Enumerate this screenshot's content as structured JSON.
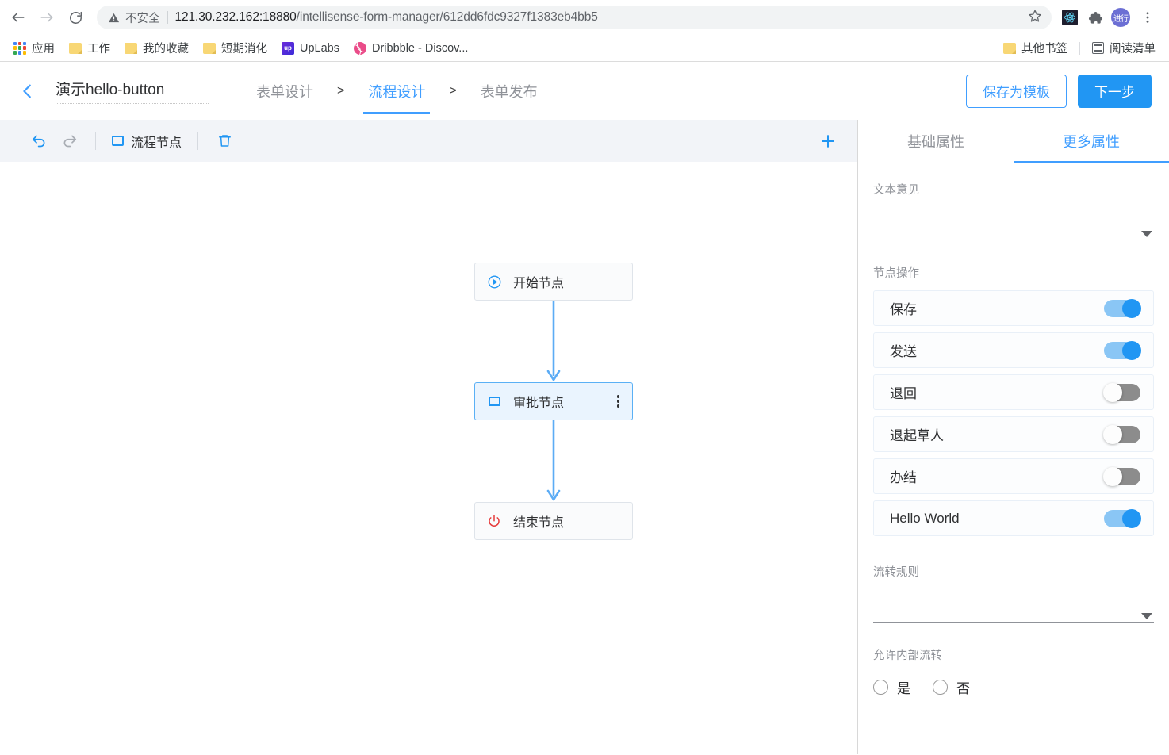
{
  "browser": {
    "nav": {
      "back_label": "Back",
      "forward_label": "Forward",
      "reload_label": "Reload"
    },
    "omnibox": {
      "security_text": "不安全",
      "url_host": "121.30.232.162:18880",
      "url_path": "/intellisense-form-manager/612dd6fdc9327f1383eb4bb5",
      "star_label": "Bookmark"
    },
    "extensions": [
      {
        "name": "react-devtools-icon"
      },
      {
        "name": "puzzle-extensions-icon"
      },
      {
        "name": "profile-avatar",
        "label": "进行"
      },
      {
        "name": "chrome-menu-icon"
      }
    ],
    "bookmarks": [
      {
        "icon": "apps-grid-icon",
        "label": "应用"
      },
      {
        "icon": "folder-icon",
        "label": "工作"
      },
      {
        "icon": "folder-icon",
        "label": "我的收藏"
      },
      {
        "icon": "folder-icon",
        "label": "短期消化"
      },
      {
        "icon": "uplabs-icon",
        "label": "UpLabs"
      },
      {
        "icon": "dribbble-icon",
        "label": "Dribbble - Discov..."
      }
    ],
    "bookmarks_right": [
      {
        "icon": "folder-icon",
        "label": "其他书签"
      },
      {
        "icon": "reading-list-icon",
        "label": "阅读清单"
      }
    ]
  },
  "app_header": {
    "back_icon": "chevron-left-icon",
    "form_title": "演示hello-button",
    "steps": [
      {
        "label": "表单设计",
        "active": false
      },
      {
        "label": "流程设计",
        "active": true
      },
      {
        "label": "表单发布",
        "active": false
      }
    ],
    "step_separator": ">",
    "save_template_label": "保存为模板",
    "next_step_label": "下一步"
  },
  "flow_toolbar": {
    "undo_icon": "undo-arrow-icon",
    "redo_icon": "redo-arrow-icon",
    "node_button_label": "流程节点",
    "delete_icon": "trash-icon",
    "add_icon": "plus-icon"
  },
  "flow": {
    "nodes": [
      {
        "icon": "play-circle-icon",
        "label": "开始节点",
        "selected": false,
        "has_menu": false
      },
      {
        "icon": "square-icon",
        "label": "审批节点",
        "selected": true,
        "has_menu": true
      },
      {
        "icon": "power-icon",
        "label": "结束节点",
        "selected": false,
        "has_menu": false
      }
    ]
  },
  "properties": {
    "tabs": [
      {
        "label": "基础属性",
        "active": false
      },
      {
        "label": "更多属性",
        "active": true
      }
    ],
    "text_opinion": {
      "label": "文本意见",
      "value": "",
      "caret_icon": "caret-down-icon"
    },
    "node_operations": {
      "label": "节点操作",
      "items": [
        {
          "label": "保存",
          "on": true
        },
        {
          "label": "发送",
          "on": true
        },
        {
          "label": "退回",
          "on": false
        },
        {
          "label": "退起草人",
          "on": false
        },
        {
          "label": "办结",
          "on": false
        },
        {
          "label": "Hello World",
          "on": true
        }
      ]
    },
    "flow_rule": {
      "label": "流转规则",
      "value": "",
      "caret_icon": "caret-down-icon"
    },
    "allow_internal": {
      "label": "允许内部流转",
      "options": [
        {
          "label": "是",
          "selected": false
        },
        {
          "label": "否",
          "selected": false
        }
      ]
    }
  },
  "colors": {
    "accent_blue": "#409eff",
    "primary_button": "#2196f3",
    "connector_blue": "#5cacf5",
    "end_node_red": "#e63c3c",
    "switch_on_track": "#8ac6f5",
    "switch_off_track": "#8c8c8c"
  }
}
